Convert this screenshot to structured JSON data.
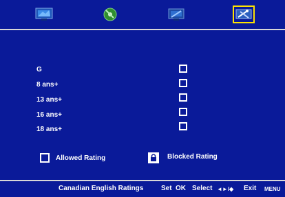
{
  "tabs": [
    {
      "name": "picture-tab-icon",
      "selected": false
    },
    {
      "name": "audio-tab-icon",
      "selected": false
    },
    {
      "name": "channel-tab-icon",
      "selected": false
    },
    {
      "name": "lock-settings-tab-icon",
      "selected": true
    }
  ],
  "ratings": [
    "G",
    "8 ans+",
    "13 ans+",
    "16 ans+",
    "18 ans+"
  ],
  "legend": {
    "allowed_label": "Allowed Rating",
    "blocked_label": "Blocked Rating"
  },
  "footer": {
    "title": "Canadian English Ratings",
    "set_label": "Set",
    "ok_label": "OK",
    "select_label": "Select",
    "select_keys": "◄►/◆",
    "exit_label": "Exit",
    "menu_label": "MENU"
  },
  "colors": {
    "background": "#0a1a99",
    "selection": "#ffe400",
    "divider": "#d8d8d8"
  }
}
